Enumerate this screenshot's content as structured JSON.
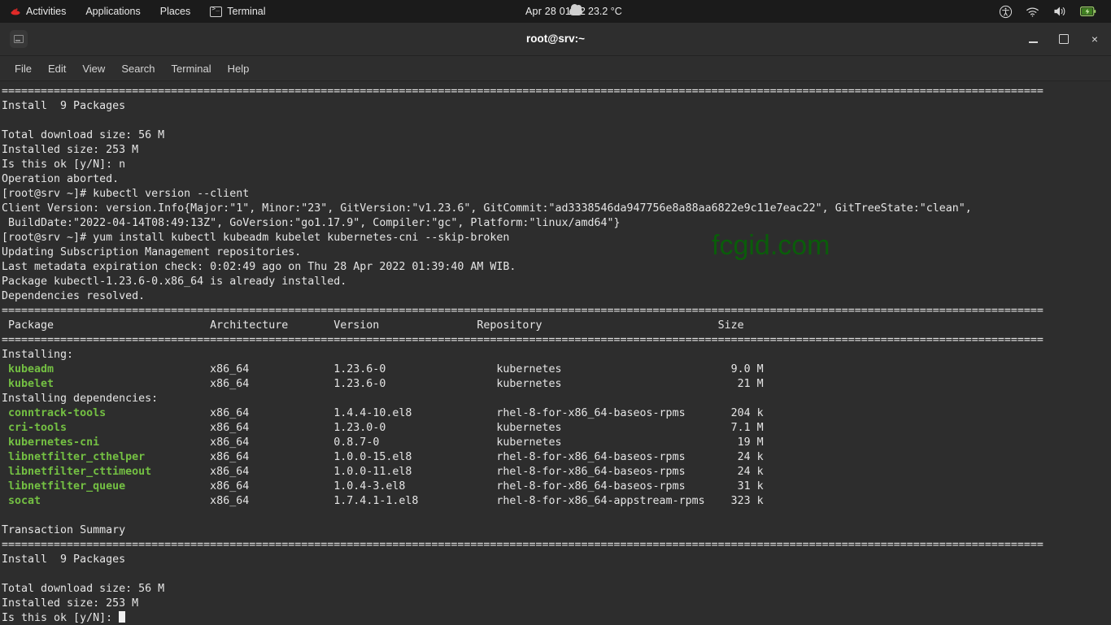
{
  "top_panel": {
    "activities": "Activities",
    "applications": "Applications",
    "places": "Places",
    "app_name": "Terminal",
    "clock": "Apr 28  01:42",
    "weather": "23.2 °C",
    "icons": {
      "redhat": "redhat-logo-icon",
      "terminal": "terminal-icon",
      "cloud": "cloud-icon",
      "accessibility": "accessibility-icon",
      "wifi": "wifi-icon",
      "volume": "volume-icon",
      "battery": "battery-charging-icon"
    }
  },
  "window": {
    "title": "root@srv:~",
    "icon": "terminal-icon",
    "buttons": {
      "minimize": "Minimize",
      "maximize": "Maximize",
      "close": "×"
    }
  },
  "menu_bar": {
    "items": [
      "File",
      "Edit",
      "View",
      "Search",
      "Terminal",
      "Help"
    ]
  },
  "watermark": "fcgid.com",
  "colors": {
    "panel_bg": "#1b1b1b",
    "terminal_bg": "#2d2d2d",
    "text": "#e5e5e5",
    "package_green": "#74c043",
    "watermark_green": "#0a5c0a"
  },
  "terminal": {
    "separator": "================================================================================================================================================================",
    "lines": [
      {
        "type": "sep"
      },
      {
        "type": "text",
        "text": "Install  9 Packages"
      },
      {
        "type": "text",
        "text": ""
      },
      {
        "type": "text",
        "text": "Total download size: 56 M"
      },
      {
        "type": "text",
        "text": "Installed size: 253 M"
      },
      {
        "type": "text",
        "text": "Is this ok [y/N]: n"
      },
      {
        "type": "text",
        "text": "Operation aborted."
      },
      {
        "type": "text",
        "text": "[root@srv ~]# kubectl version --client"
      },
      {
        "type": "text",
        "text": "Client Version: version.Info{Major:\"1\", Minor:\"23\", GitVersion:\"v1.23.6\", GitCommit:\"ad3338546da947756e8a88aa6822e9c11e7eac22\", GitTreeState:\"clean\","
      },
      {
        "type": "text",
        "text": " BuildDate:\"2022-04-14T08:49:13Z\", GoVersion:\"go1.17.9\", Compiler:\"gc\", Platform:\"linux/amd64\"}"
      },
      {
        "type": "text",
        "text": "[root@srv ~]# yum install kubectl kubeadm kubelet kubernetes-cni --skip-broken"
      },
      {
        "type": "text",
        "text": "Updating Subscription Management repositories."
      },
      {
        "type": "text",
        "text": "Last metadata expiration check: 0:02:49 ago on Thu 28 Apr 2022 01:39:40 AM WIB."
      },
      {
        "type": "text",
        "text": "Package kubectl-1.23.6-0.x86_64 is already installed."
      },
      {
        "type": "text",
        "text": "Dependencies resolved."
      },
      {
        "type": "sep"
      },
      {
        "type": "text",
        "text": " Package                        Architecture       Version               Repository                           Size"
      },
      {
        "type": "sep"
      },
      {
        "type": "text",
        "text": "Installing:"
      },
      {
        "type": "pkg",
        "name": "kubeadm",
        "arch": "x86_64",
        "version": "1.23.6-0",
        "repo": "kubernetes",
        "size": "9.0 M"
      },
      {
        "type": "pkg",
        "name": "kubelet",
        "arch": "x86_64",
        "version": "1.23.6-0",
        "repo": "kubernetes",
        "size": "21 M"
      },
      {
        "type": "text",
        "text": "Installing dependencies:"
      },
      {
        "type": "pkg",
        "name": "conntrack-tools",
        "arch": "x86_64",
        "version": "1.4.4-10.el8",
        "repo": "rhel-8-for-x86_64-baseos-rpms",
        "size": "204 k"
      },
      {
        "type": "pkg",
        "name": "cri-tools",
        "arch": "x86_64",
        "version": "1.23.0-0",
        "repo": "kubernetes",
        "size": "7.1 M"
      },
      {
        "type": "pkg",
        "name": "kubernetes-cni",
        "arch": "x86_64",
        "version": "0.8.7-0",
        "repo": "kubernetes",
        "size": "19 M"
      },
      {
        "type": "pkg",
        "name": "libnetfilter_cthelper",
        "arch": "x86_64",
        "version": "1.0.0-15.el8",
        "repo": "rhel-8-for-x86_64-baseos-rpms",
        "size": "24 k"
      },
      {
        "type": "pkg",
        "name": "libnetfilter_cttimeout",
        "arch": "x86_64",
        "version": "1.0.0-11.el8",
        "repo": "rhel-8-for-x86_64-baseos-rpms",
        "size": "24 k"
      },
      {
        "type": "pkg",
        "name": "libnetfilter_queue",
        "arch": "x86_64",
        "version": "1.0.4-3.el8",
        "repo": "rhel-8-for-x86_64-baseos-rpms",
        "size": "31 k"
      },
      {
        "type": "pkg",
        "name": "socat",
        "arch": "x86_64",
        "version": "1.7.4.1-1.el8",
        "repo": "rhel-8-for-x86_64-appstream-rpms",
        "size": "323 k"
      },
      {
        "type": "text",
        "text": ""
      },
      {
        "type": "text",
        "text": "Transaction Summary"
      },
      {
        "type": "sep"
      },
      {
        "type": "text",
        "text": "Install  9 Packages"
      },
      {
        "type": "text",
        "text": ""
      },
      {
        "type": "text",
        "text": "Total download size: 56 M"
      },
      {
        "type": "text",
        "text": "Installed size: 253 M"
      },
      {
        "type": "prompt",
        "text": "Is this ok [y/N]: "
      }
    ],
    "columns": {
      "package": "Package",
      "architecture": "Architecture",
      "version": "Version",
      "repository": "Repository",
      "size": "Size"
    }
  }
}
